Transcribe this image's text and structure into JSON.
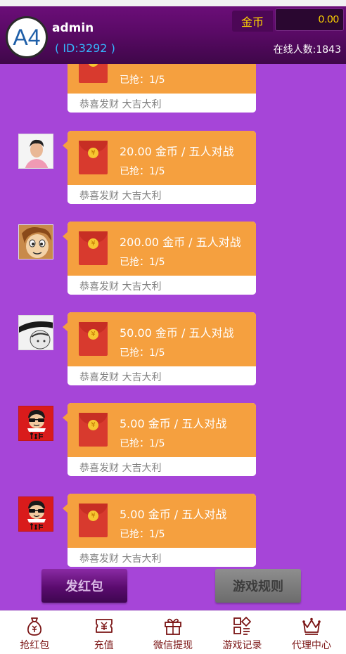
{
  "header": {
    "avatar_text": "A4",
    "username": "admin",
    "user_id": "( ID:3292 )",
    "coin_label": "金币",
    "coin_value": "0.00",
    "online": "在线人数:1843"
  },
  "messages": [
    {
      "amount": "",
      "grabbed": "已抢：1/5",
      "blessing": "恭喜发财 大吉大利"
    },
    {
      "amount": "20.00 金币 / 五人对战",
      "grabbed": "已抢：1/5",
      "blessing": "恭喜发财 大吉大利"
    },
    {
      "amount": "200.00 金币 / 五人对战",
      "grabbed": "已抢：1/5",
      "blessing": "恭喜发财 大吉大利"
    },
    {
      "amount": "50.00 金币 / 五人对战",
      "grabbed": "已抢：1/5",
      "blessing": "恭喜发财 大吉大利"
    },
    {
      "amount": "5.00 金币 / 五人对战",
      "grabbed": "已抢：1/5",
      "blessing": "恭喜发财 大吉大利"
    },
    {
      "amount": "5.00 金币 / 五人对战",
      "grabbed": "已抢：1/5",
      "blessing": "恭喜发财 大吉大利"
    }
  ],
  "actions": {
    "send_label": "发红包",
    "rules_label": "游戏规则"
  },
  "nav": [
    {
      "label": "抢红包",
      "icon": "money-bag-icon"
    },
    {
      "label": "充值",
      "icon": "yuan-ticket-icon"
    },
    {
      "label": "微信提现",
      "icon": "gift-icon"
    },
    {
      "label": "游戏记录",
      "icon": "record-grid-icon"
    },
    {
      "label": "代理中心",
      "icon": "crown-icon"
    }
  ],
  "colors": {
    "header": "#5a0a66",
    "chat_bg": "#a645d8",
    "bubble": "#f5a03f",
    "envelope": "#d83a2e",
    "coin_text": "#ffd400",
    "id_text": "#35b7ff",
    "nav_text": "#7a1414"
  }
}
